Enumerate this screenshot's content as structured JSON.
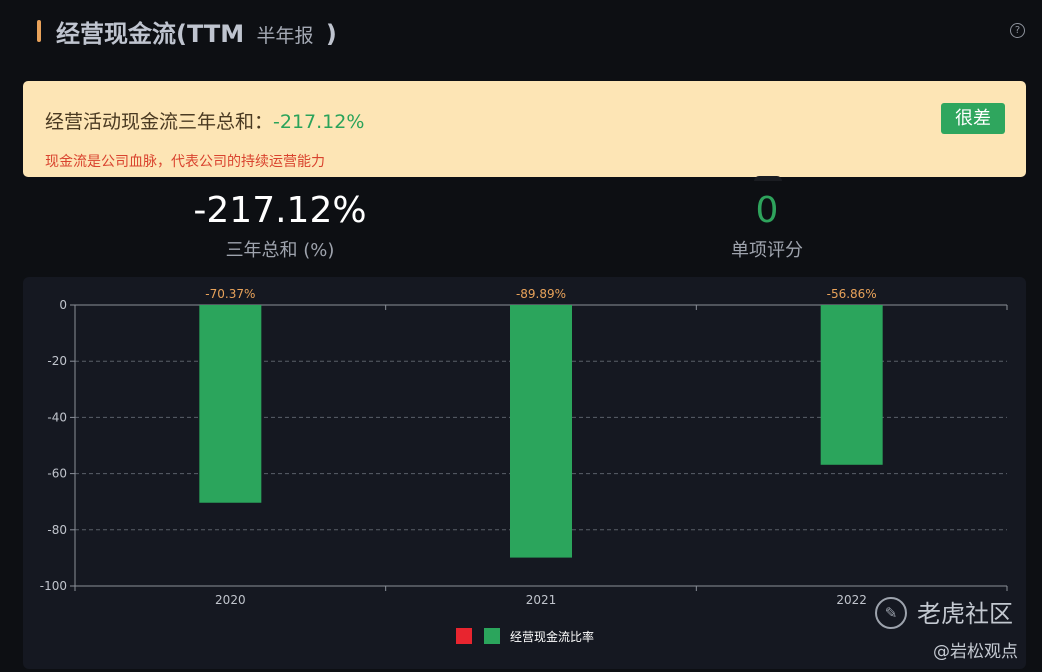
{
  "header": {
    "title": "经营现金流(TTM",
    "subtitle": "半年报",
    "title_suffix": ")",
    "help_icon": "question-circle-icon"
  },
  "banner": {
    "label": "经营活动现金流三年总和：",
    "value": "-217.12%",
    "note": "现金流是公司血脉，代表公司的持续运营能力",
    "rating": "很差"
  },
  "stats": {
    "total": {
      "value": "-217.12%",
      "label": "三年总和 (%)"
    },
    "score": {
      "value": "0",
      "label": "单项评分"
    }
  },
  "watermark": {
    "logo_icon": "tiger-logo-icon",
    "community": "老虎社区",
    "handle": "@岩松观点"
  },
  "colors": {
    "positive": "#e8252f",
    "negative": "#2ba55c",
    "label": "#e8a25a"
  },
  "chart_data": {
    "type": "bar",
    "categories": [
      "2020",
      "2021",
      "2022"
    ],
    "values": [
      -70.37,
      -89.89,
      -56.86
    ],
    "data_labels": [
      "-70.37%",
      "-89.89%",
      "-56.86%"
    ],
    "ylim": [
      -100,
      0
    ],
    "yticks": [
      0,
      -20,
      -40,
      -60,
      -80,
      -100
    ],
    "grid": true,
    "legend_position": "bottom",
    "legend": {
      "label": "经营现金流比率",
      "swatches": [
        "#e8252f",
        "#2ba55c"
      ]
    }
  }
}
